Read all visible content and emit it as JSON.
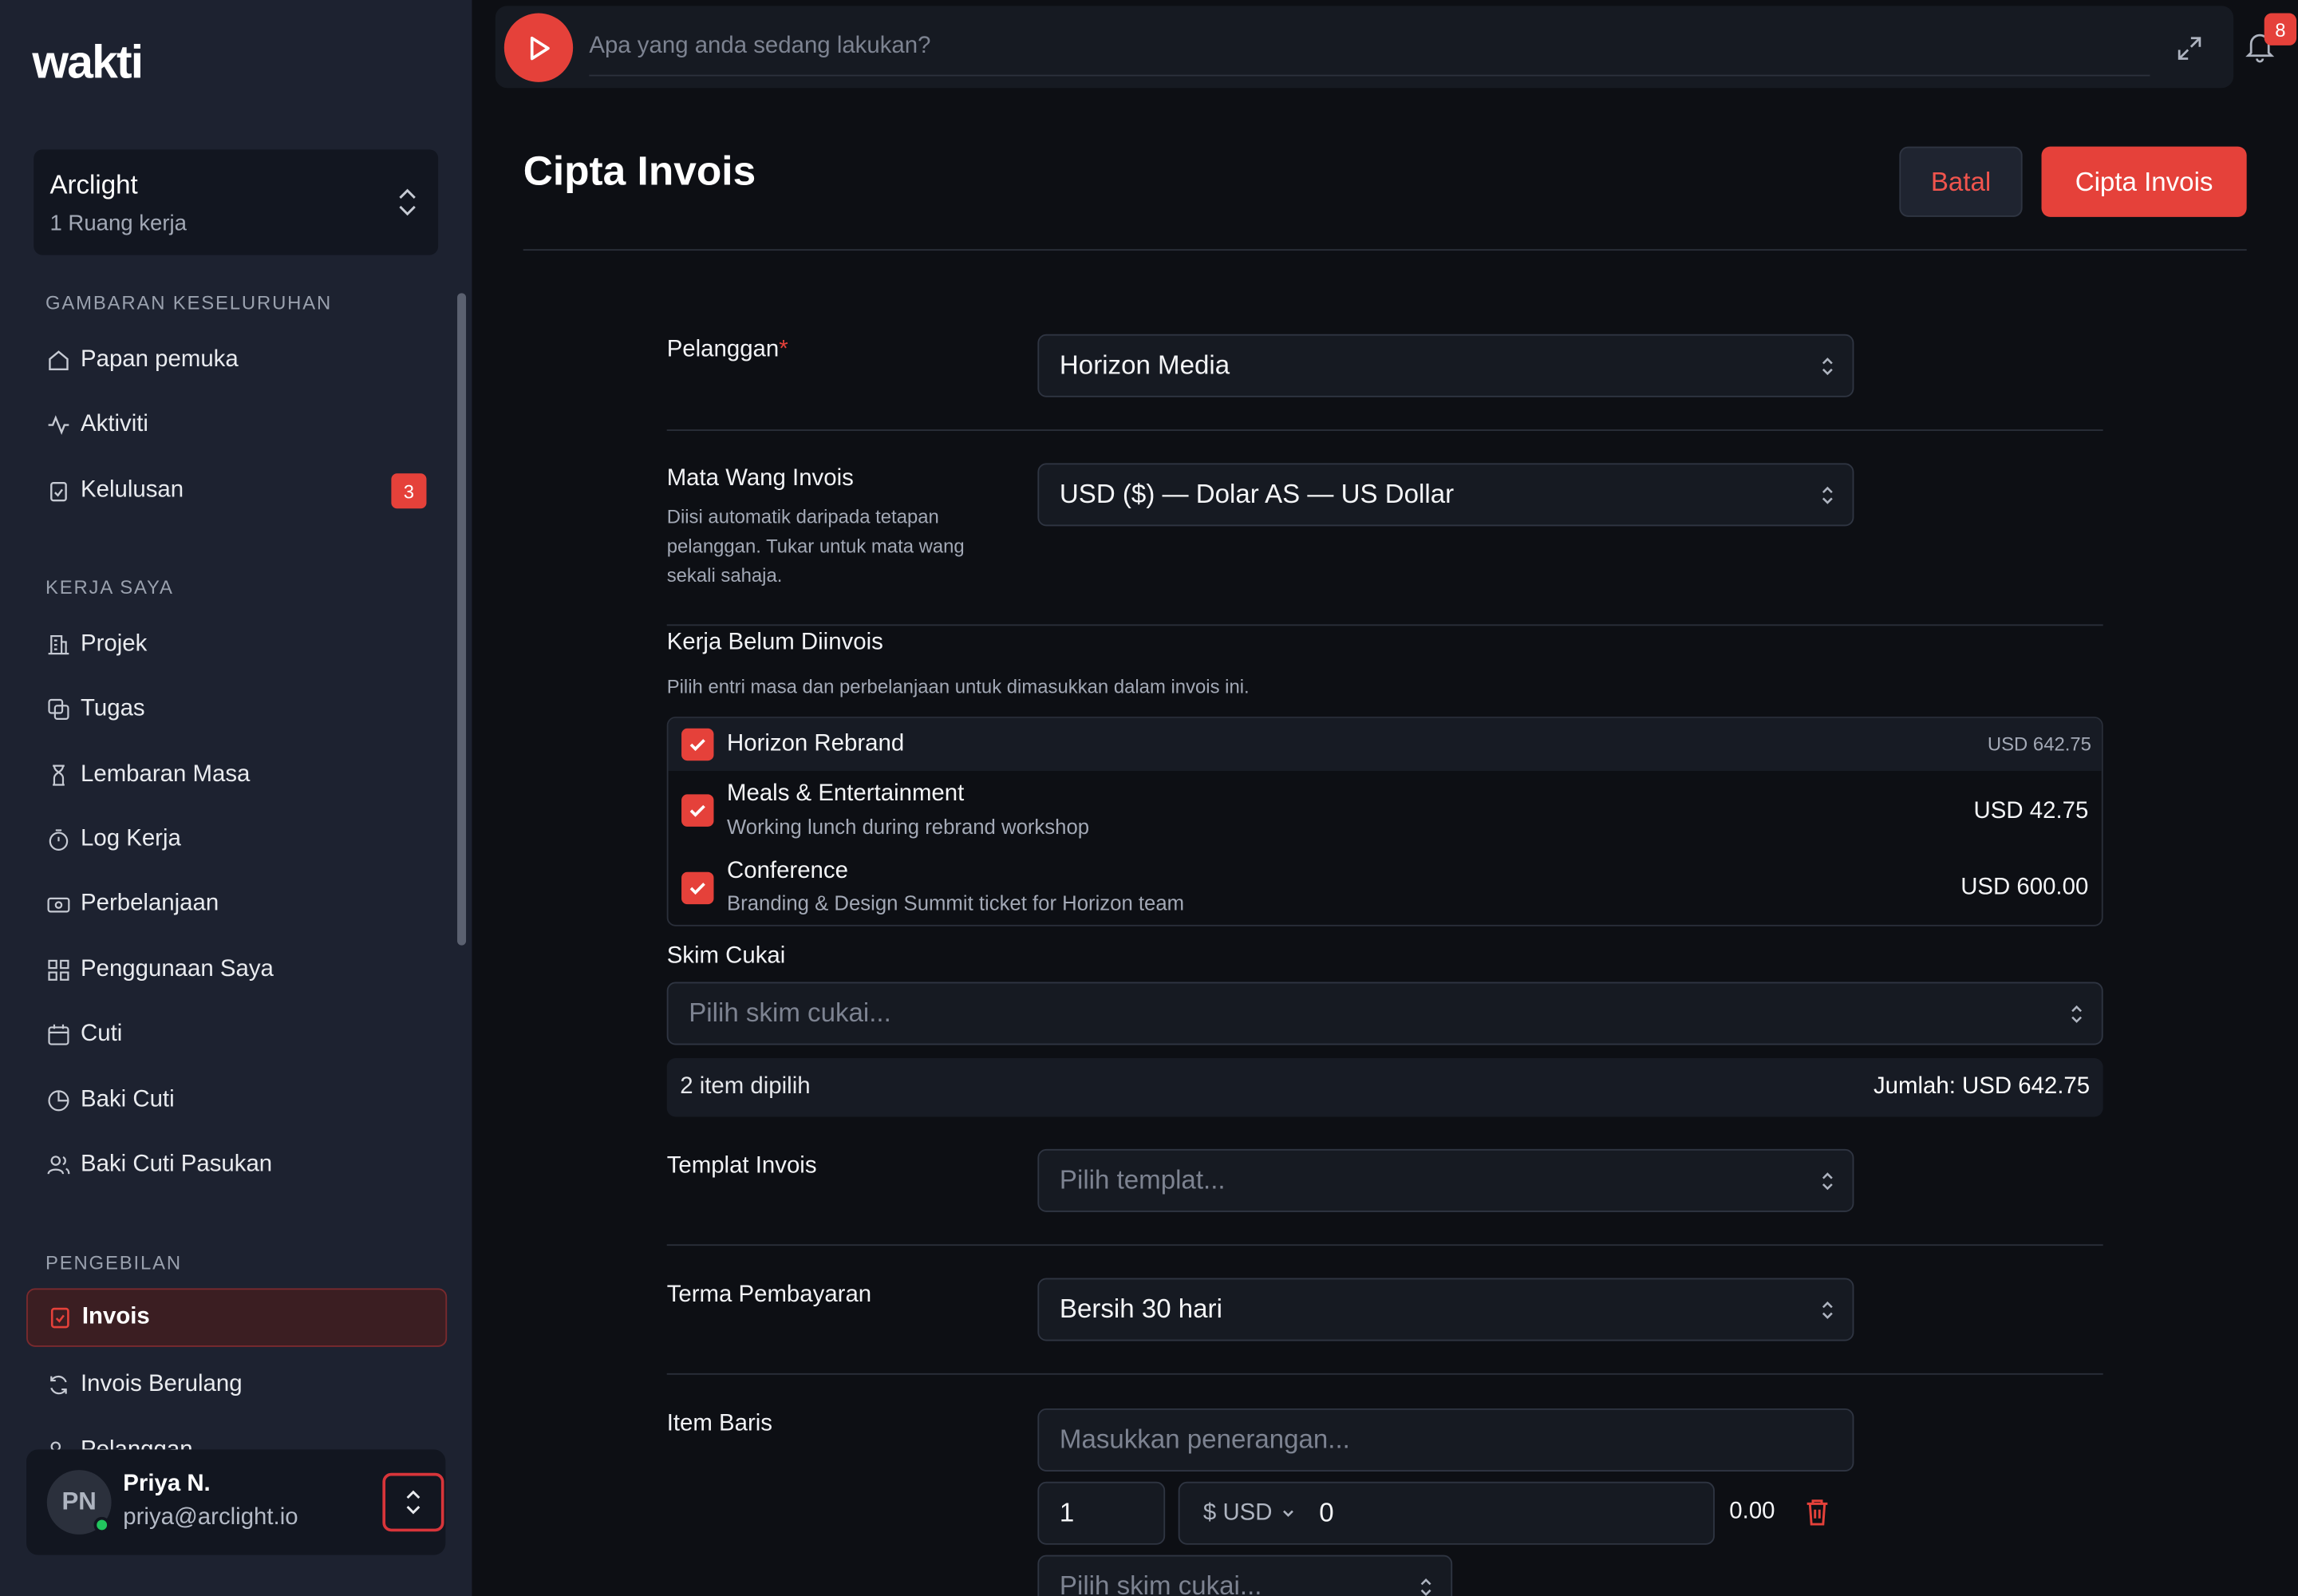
{
  "app": {
    "logo": "wakti"
  },
  "workspace": {
    "name": "Arclight",
    "sub": "1 Ruang kerja"
  },
  "sidebar": {
    "sections": [
      {
        "title": "GAMBARAN KESELURUHAN"
      },
      {
        "title": "KERJA SAYA"
      },
      {
        "title": "PENGEBILAN"
      }
    ],
    "overview": [
      {
        "label": "Papan pemuka",
        "icon": "home-icon"
      },
      {
        "label": "Aktiviti",
        "icon": "activity-icon"
      },
      {
        "label": "Kelulusan",
        "icon": "clipboard-check-icon",
        "badge": "3"
      }
    ],
    "mywork": [
      {
        "label": "Projek",
        "icon": "building-icon"
      },
      {
        "label": "Tugas",
        "icon": "copy-icon"
      },
      {
        "label": "Lembaran Masa",
        "icon": "hourglass-icon"
      },
      {
        "label": "Log Kerja",
        "icon": "timer-icon"
      },
      {
        "label": "Perbelanjaan",
        "icon": "banknote-icon"
      },
      {
        "label": "Penggunaan Saya",
        "icon": "grid-icon"
      },
      {
        "label": "Cuti",
        "icon": "calendar-icon"
      },
      {
        "label": "Baki Cuti",
        "icon": "pie-chart-icon"
      },
      {
        "label": "Baki Cuti Pasukan",
        "icon": "users-icon"
      }
    ],
    "billing": [
      {
        "label": "Invois",
        "icon": "invoice-icon",
        "active": true
      },
      {
        "label": "Invois Berulang",
        "icon": "repeat-icon"
      },
      {
        "label": "Pelanggan",
        "icon": "users-icon"
      }
    ]
  },
  "user": {
    "initials": "PN",
    "name": "Priya N.",
    "email": "priya@arclight.io"
  },
  "topbar": {
    "placeholder": "Apa yang anda sedang lakukan?",
    "notifications": "8"
  },
  "page": {
    "title": "Cipta Invois",
    "cancel_label": "Batal",
    "create_label": "Cipta Invois"
  },
  "form": {
    "customer": {
      "label": "Pelanggan",
      "required": "*",
      "value": "Horizon Media"
    },
    "currency": {
      "label": "Mata Wang Invois",
      "help": "Diisi automatik daripada tetapan pelanggan. Tukar untuk mata wang sekali sahaja.",
      "value": "USD ($) — Dolar AS — US Dollar"
    },
    "unbilled": {
      "label": "Kerja Belum Diinvois",
      "help": "Pilih entri masa dan perbelanjaan untuk dimasukkan dalam invois ini.",
      "group": {
        "title": "Horizon Rebrand",
        "amount": "USD 642.75"
      },
      "items": [
        {
          "title": "Meals & Entertainment",
          "sub": "Working lunch during rebrand workshop",
          "amount": "USD 42.75"
        },
        {
          "title": "Conference",
          "sub": "Branding & Design Summit ticket for Horizon team",
          "amount": "USD 600.00"
        }
      ]
    },
    "tax": {
      "label": "Skim Cukai",
      "placeholder": "Pilih skim cukai..."
    },
    "summary": {
      "count": "2 item dipilih",
      "total": "Jumlah: USD 642.75"
    },
    "template": {
      "label": "Templat Invois",
      "placeholder": "Pilih templat..."
    },
    "terms": {
      "label": "Terma Pembayaran",
      "value": "Bersih 30 hari"
    },
    "line_items": {
      "label": "Item Baris",
      "desc_placeholder": "Masukkan penerangan...",
      "qty": "1",
      "currency": "$ USD",
      "price": "0",
      "total": "0.00",
      "tax_placeholder": "Pilih skim cukai..."
    }
  },
  "colors": {
    "accent": "#e5413a",
    "sidebar": "#1d2230",
    "background": "#0d0f14"
  }
}
